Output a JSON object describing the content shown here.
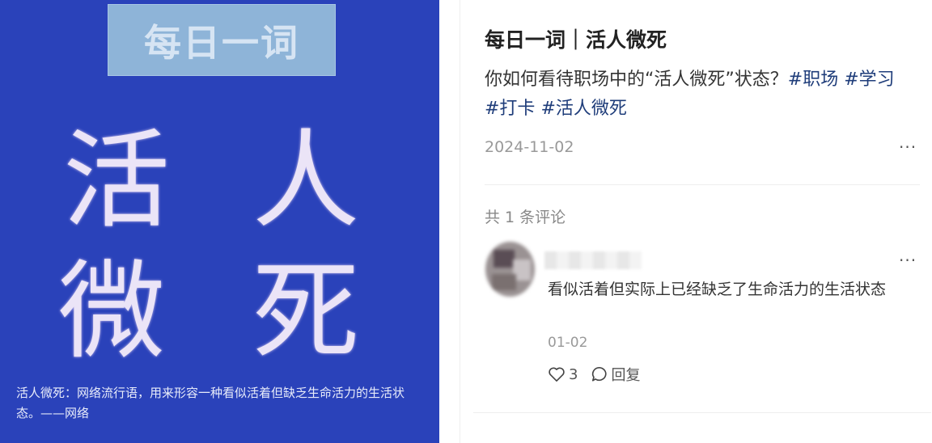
{
  "image": {
    "title_box": "每日一词",
    "big_chars": [
      "活",
      "人",
      "微",
      "死"
    ],
    "caption": "活人微死：网络流行语，用来形容一种看似活着但缺乏生命活力的生活状态。——网络"
  },
  "post": {
    "title": "每日一词｜活人微死",
    "body_text": "你如何看待职场中的“活人微死”状态？",
    "tags": [
      "#职场",
      "#学习",
      "#打卡",
      "#活人微死"
    ],
    "date": "2024-11-02",
    "more_label": "···"
  },
  "comments": {
    "count_label": "共 1 条评论",
    "items": [
      {
        "text": "看似活着但实际上已经缺乏了生命活力的生活状态",
        "date": "01-02",
        "like_count": "3",
        "reply_label": "回复",
        "more_label": "···"
      }
    ]
  },
  "colors": {
    "image_bg": "#2a42ba",
    "title_box_bg": "#8eb4d8",
    "tag": "#1f3d7a"
  }
}
